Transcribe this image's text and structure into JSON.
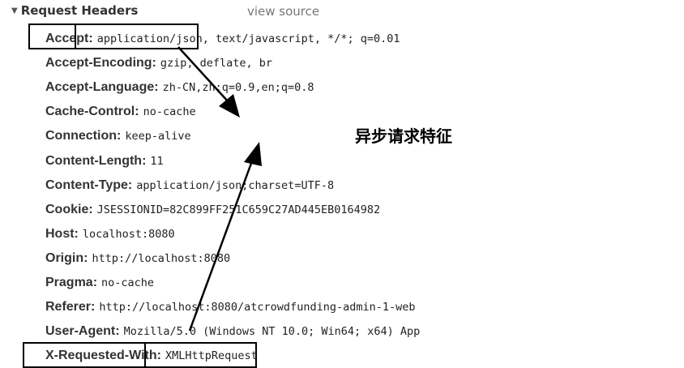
{
  "section": {
    "title": "Request Headers",
    "view_source": "view source"
  },
  "headers": [
    {
      "name": "Accept:",
      "value": "application/json, text/javascript, */*; q=0.01"
    },
    {
      "name": "Accept-Encoding:",
      "value": "gzip, deflate, br"
    },
    {
      "name": "Accept-Language:",
      "value": "zh-CN,zh;q=0.9,en;q=0.8"
    },
    {
      "name": "Cache-Control:",
      "value": "no-cache"
    },
    {
      "name": "Connection:",
      "value": "keep-alive"
    },
    {
      "name": "Content-Length:",
      "value": "11"
    },
    {
      "name": "Content-Type:",
      "value": "application/json;charset=UTF-8"
    },
    {
      "name": "Cookie:",
      "value": "JSESSIONID=82C899FF251C659C27AD445EB0164982"
    },
    {
      "name": "Host:",
      "value": "localhost:8080"
    },
    {
      "name": "Origin:",
      "value": "http://localhost:8080"
    },
    {
      "name": "Pragma:",
      "value": "no-cache"
    },
    {
      "name": "Referer:",
      "value": "http://localhost:8080/atcrowdfunding-admin-1-web"
    },
    {
      "name": "User-Agent:",
      "value": "Mozilla/5.0 (Windows NT 10.0; Win64; x64) App"
    },
    {
      "name": "X-Requested-With:",
      "value": "XMLHttpRequest"
    }
  ],
  "annotation": "异步请求特征"
}
